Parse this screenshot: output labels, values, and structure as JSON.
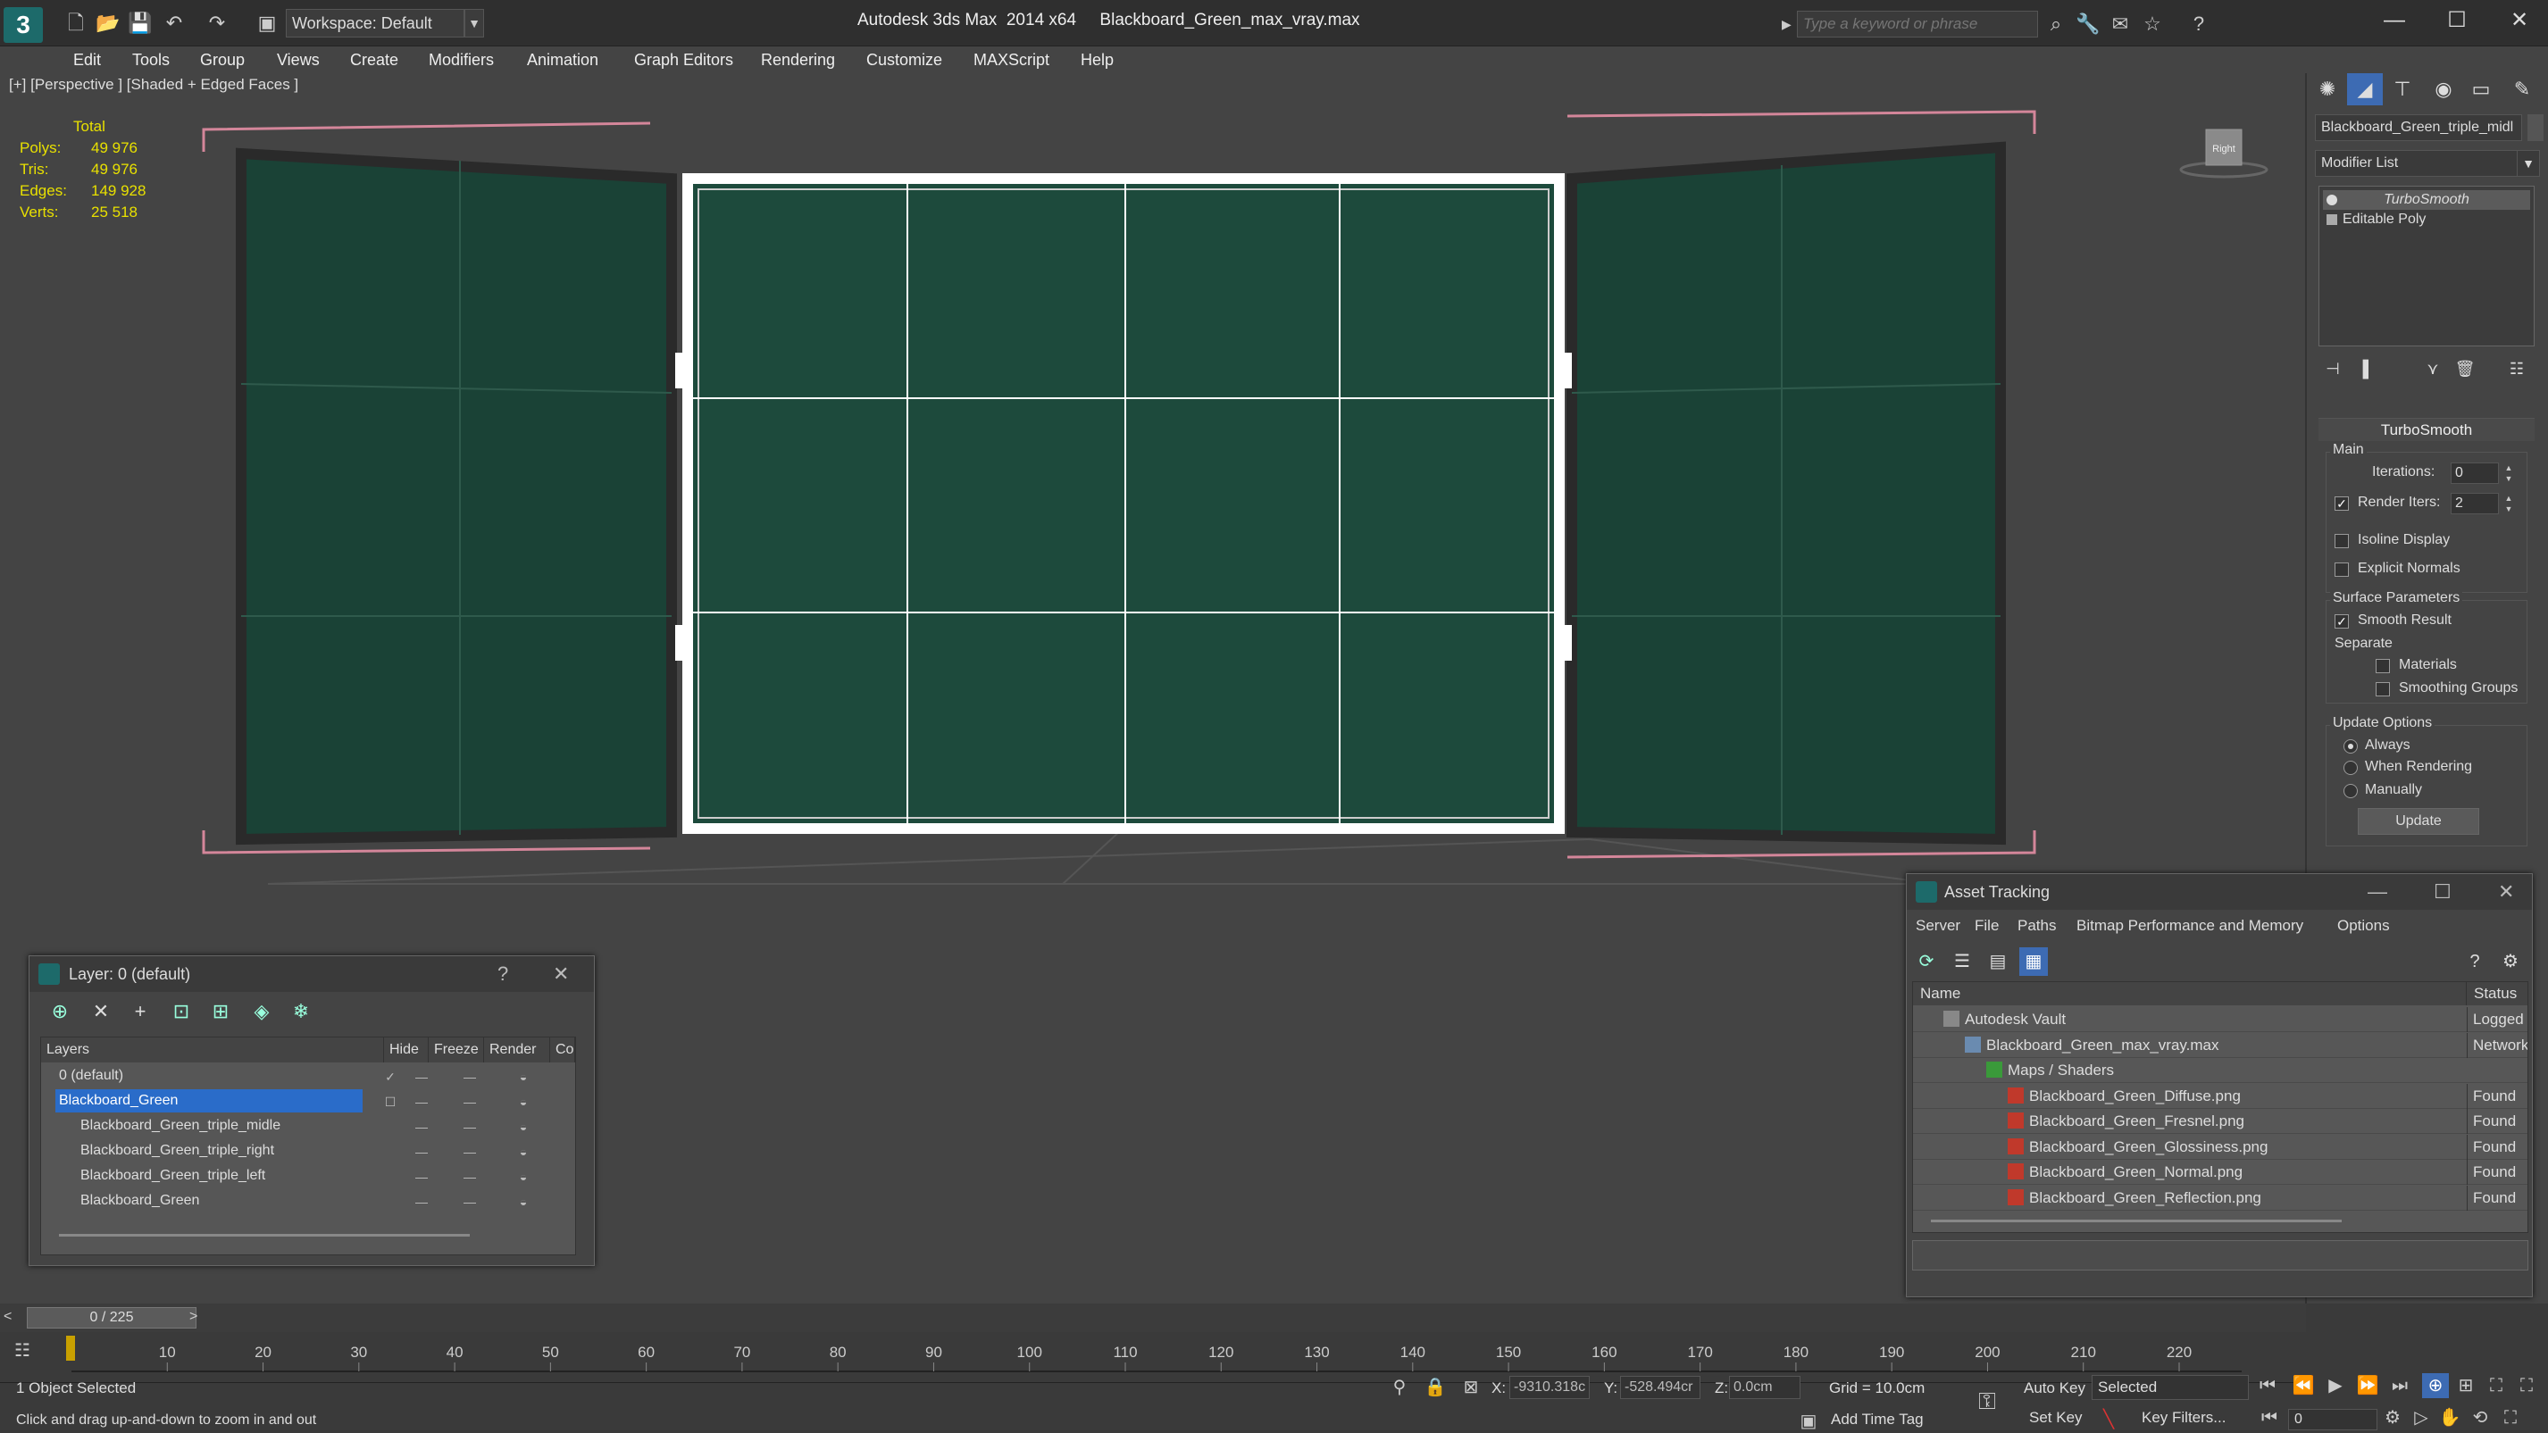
{
  "app": {
    "logo": "3",
    "title": "Autodesk 3ds Max  2014 x64     Blackboard_Green_max_vray.max",
    "workspace": "Workspace: Default",
    "search_placeholder": "Type a keyword or phrase",
    "minimize": "—",
    "maximize": "☐",
    "close": "✕"
  },
  "menu": [
    "Edit",
    "Tools",
    "Group",
    "Views",
    "Create",
    "Modifiers",
    "Animation",
    "Graph Editors",
    "Rendering",
    "Customize",
    "MAXScript",
    "Help"
  ],
  "viewport": {
    "label": "[+] [Perspective ] [Shaded + Edged Faces ]",
    "stats_header": "Total",
    "stats": [
      {
        "label": "Polys:",
        "value": "49 976"
      },
      {
        "label": "Tris:",
        "value": "49 976"
      },
      {
        "label": "Edges:",
        "value": "149 928"
      },
      {
        "label": "Verts:",
        "value": "25 518"
      }
    ],
    "board_color": "#1d4a3c",
    "frame_color": "#ffffff",
    "viewcube_label": "Right"
  },
  "command_panel": {
    "object_name": "Blackboard_Green_triple_midl",
    "modifier_list": "Modifier List",
    "stack": [
      "TurboSmooth",
      "Editable Poly"
    ],
    "rollout_title": "TurboSmooth",
    "main_group": "Main",
    "iterations_label": "Iterations:",
    "iterations_value": "0",
    "render_iters_label": "Render Iters:",
    "render_iters_value": "2",
    "isoline_label": "Isoline Display",
    "explicit_label": "Explicit Normals",
    "surface_group": "Surface Parameters",
    "smooth_result_label": "Smooth Result",
    "separate_label": "Separate",
    "materials_label": "Materials",
    "smoothing_groups_label": "Smoothing Groups",
    "update_group": "Update Options",
    "always_label": "Always",
    "when_rendering_label": "When Rendering",
    "manually_label": "Manually",
    "update_button": "Update"
  },
  "layer_dialog": {
    "title": "Layer: 0 (default)",
    "help": "?",
    "close": "✕",
    "columns": [
      "Layers",
      "Hide",
      "Freeze",
      "Render",
      "Co"
    ],
    "rows": [
      {
        "name": "0 (default)",
        "indent": 1,
        "selected": false,
        "current": "✓"
      },
      {
        "name": "Blackboard_Green",
        "indent": 1,
        "selected": true,
        "current": "☐"
      },
      {
        "name": "Blackboard_Green_triple_midle",
        "indent": 2,
        "selected": false,
        "current": ""
      },
      {
        "name": "Blackboard_Green_triple_right",
        "indent": 2,
        "selected": false,
        "current": ""
      },
      {
        "name": "Blackboard_Green_triple_left",
        "indent": 2,
        "selected": false,
        "current": ""
      },
      {
        "name": "Blackboard_Green",
        "indent": 2,
        "selected": false,
        "current": ""
      }
    ],
    "dash": "—"
  },
  "asset_dialog": {
    "title": "Asset Tracking",
    "menu": [
      "Server",
      "File",
      "Paths",
      "Bitmap Performance and Memory",
      "Options"
    ],
    "columns": [
      "Name",
      "Status"
    ],
    "rows": [
      {
        "name": "Autodesk Vault",
        "status": "Logged O",
        "indent": 1,
        "icon": "vault"
      },
      {
        "name": "Blackboard_Green_max_vray.max",
        "status": "Network",
        "indent": 2,
        "icon": "max"
      },
      {
        "name": "Maps / Shaders",
        "status": "",
        "indent": 3,
        "icon": "maps"
      },
      {
        "name": "Blackboard_Green_Diffuse.png",
        "status": "Found",
        "indent": 4,
        "icon": "png"
      },
      {
        "name": "Blackboard_Green_Fresnel.png",
        "status": "Found",
        "indent": 4,
        "icon": "png"
      },
      {
        "name": "Blackboard_Green_Glossiness.png",
        "status": "Found",
        "indent": 4,
        "icon": "png"
      },
      {
        "name": "Blackboard_Green_Normal.png",
        "status": "Found",
        "indent": 4,
        "icon": "png"
      },
      {
        "name": "Blackboard_Green_Reflection.png",
        "status": "Found",
        "indent": 4,
        "icon": "png"
      }
    ]
  },
  "timeline": {
    "frame_display": "0 / 225",
    "ticks": [
      "10",
      "20",
      "30",
      "40",
      "50",
      "60",
      "70",
      "80",
      "90",
      "100",
      "110",
      "120",
      "130",
      "140",
      "150",
      "160",
      "170",
      "180",
      "190",
      "200",
      "210",
      "220"
    ]
  },
  "status": {
    "selection": "1 Object Selected",
    "prompt": "Click and drag up-and-down to zoom in and out",
    "x_label": "X:",
    "x_value": "-9310.318c",
    "y_label": "Y:",
    "y_value": "-528.494cr",
    "z_label": "Z:",
    "z_value": "0.0cm",
    "grid": "Grid = 10.0cm",
    "add_time_tag": "Add Time Tag",
    "auto_key": "Auto Key",
    "set_key": "Set Key",
    "selected_option": "Selected",
    "key_filters": "Key Filters...",
    "frame_value": "0"
  }
}
